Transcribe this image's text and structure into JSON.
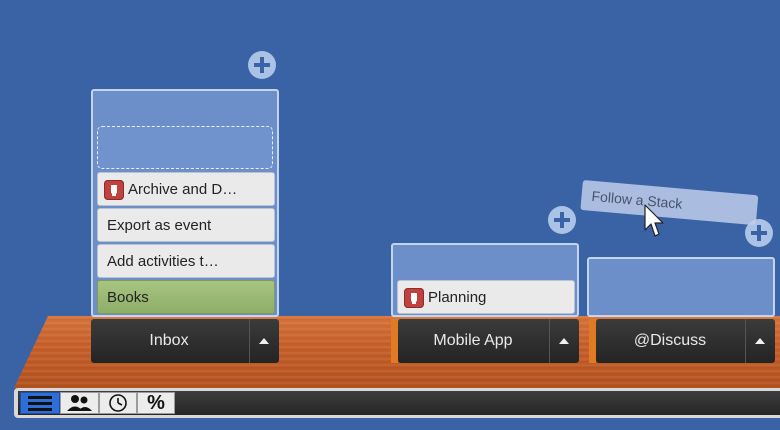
{
  "stacks": [
    {
      "name": "Inbox",
      "cards": [
        {
          "label": "Archive and D…",
          "icon": "evernote-icon"
        },
        {
          "label": "Export as event"
        },
        {
          "label": "Add activities t…"
        },
        {
          "label": "Books",
          "highlight": "#9ab674"
        }
      ]
    },
    {
      "name": "Mobile App",
      "cards": [
        {
          "label": "Planning",
          "icon": "evernote-icon"
        }
      ]
    },
    {
      "name": "@Discuss",
      "cards": []
    }
  ],
  "dragged_card": {
    "label": "Follow a Stack"
  },
  "toolbar": {
    "buttons": [
      {
        "icon": "list-icon",
        "active": true
      },
      {
        "icon": "people-icon",
        "active": false
      },
      {
        "icon": "clock-icon",
        "active": false
      },
      {
        "label": "%",
        "active": false
      }
    ]
  },
  "colors": {
    "background": "#3a63a6",
    "shelf": "#c8602a",
    "accent": "#e07a23",
    "tag": "#c0423f"
  }
}
